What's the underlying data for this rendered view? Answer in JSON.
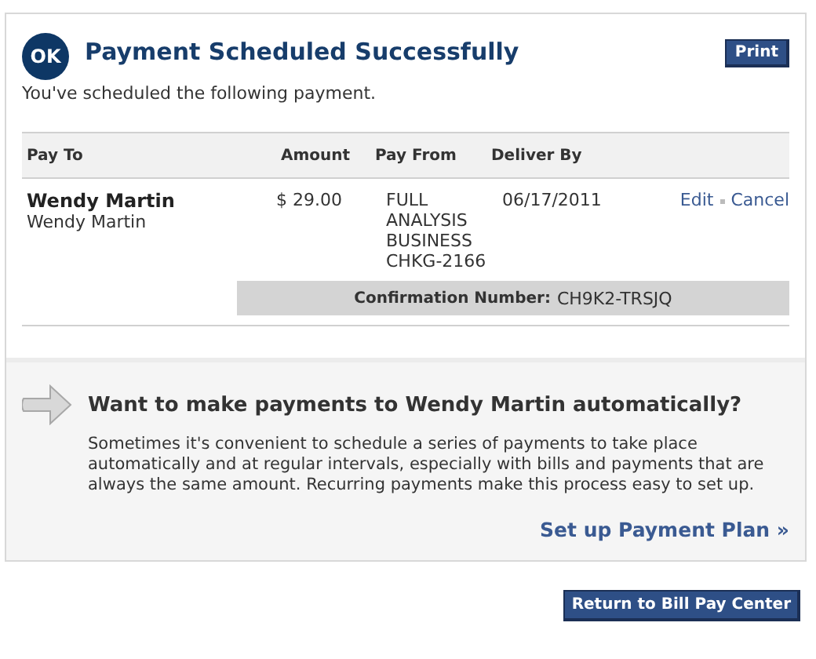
{
  "header": {
    "badge": "OK",
    "title": "Payment Scheduled Successfully",
    "print_button": "Print",
    "subtitle": "You've scheduled the following payment."
  },
  "table": {
    "columns": [
      "Pay To",
      "Amount",
      "Pay From",
      "Deliver By"
    ],
    "rows": [
      {
        "payee": "Wendy Martin",
        "payee_nickname": "Wendy Martin",
        "amount": "$ 29.00",
        "pay_from": [
          "FULL",
          "ANALYSIS",
          "BUSINESS",
          "CHKG-2166"
        ],
        "deliver_by": "06/17/2011",
        "actions": [
          "Edit",
          "Cancel"
        ],
        "confirmation_label": "Confirmation Number:",
        "confirmation_number": "CH9K2-TRSJQ"
      }
    ]
  },
  "promo": {
    "title": "Want to make payments to Wendy Martin automatically?",
    "text": "Sometimes it's convenient to schedule a series of payments to take place automatically and at regular intervals, especially with bills and payments that are always the same amount. Recurring payments make this process easy to set up.",
    "link": "Set up Payment Plan »"
  },
  "return_button": "Return to Bill Pay Center"
}
